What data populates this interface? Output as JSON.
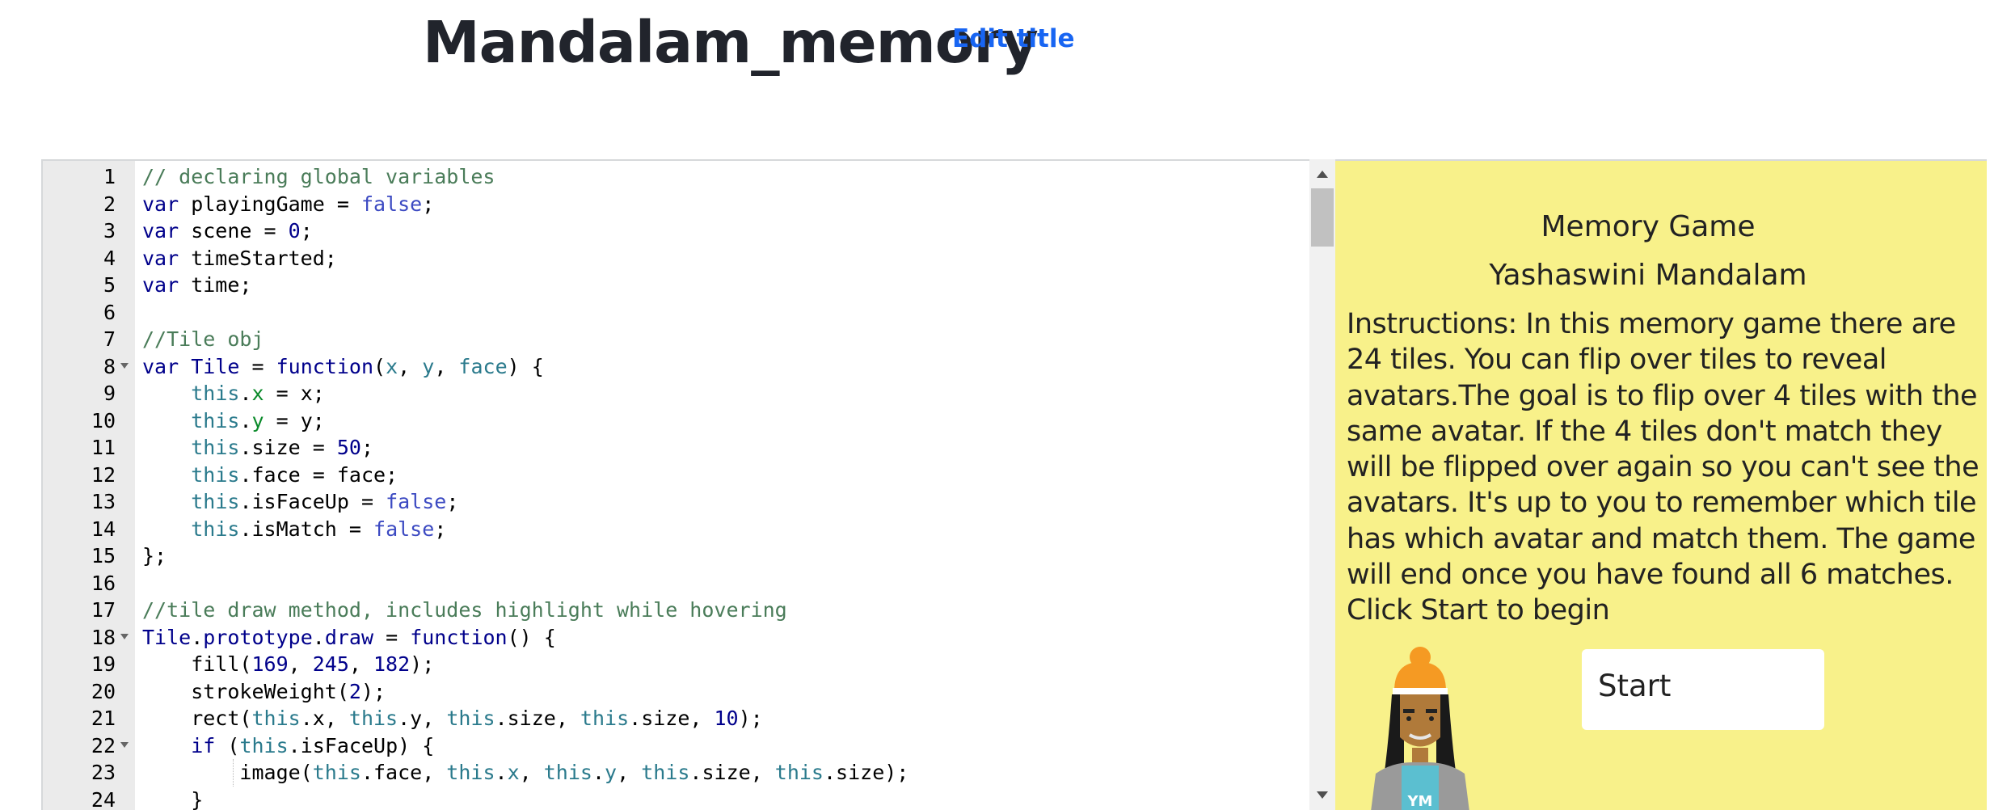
{
  "header": {
    "title": "Mandalam_memory",
    "edit_title_label": "Edit title"
  },
  "editor": {
    "lines": [
      {
        "n": "1",
        "fold": false,
        "tokens": [
          {
            "t": "// declaring global variables",
            "c": "comment"
          }
        ]
      },
      {
        "n": "2",
        "fold": false,
        "tokens": [
          {
            "t": "var",
            "c": "kw"
          },
          {
            "t": " playingGame = ",
            "c": ""
          },
          {
            "t": "false",
            "c": "bool"
          },
          {
            "t": ";",
            "c": ""
          }
        ]
      },
      {
        "n": "3",
        "fold": false,
        "tokens": [
          {
            "t": "var",
            "c": "kw"
          },
          {
            "t": " scene = ",
            "c": ""
          },
          {
            "t": "0",
            "c": "num"
          },
          {
            "t": ";",
            "c": ""
          }
        ]
      },
      {
        "n": "4",
        "fold": false,
        "tokens": [
          {
            "t": "var",
            "c": "kw"
          },
          {
            "t": " timeStarted;",
            "c": ""
          }
        ]
      },
      {
        "n": "5",
        "fold": false,
        "tokens": [
          {
            "t": "var",
            "c": "kw"
          },
          {
            "t": " time;",
            "c": ""
          }
        ]
      },
      {
        "n": "6",
        "fold": false,
        "tokens": []
      },
      {
        "n": "7",
        "fold": false,
        "tokens": [
          {
            "t": "//Tile obj",
            "c": "comment"
          }
        ]
      },
      {
        "n": "8",
        "fold": true,
        "tokens": [
          {
            "t": "var",
            "c": "kw"
          },
          {
            "t": " ",
            "c": ""
          },
          {
            "t": "Tile",
            "c": "fn"
          },
          {
            "t": " = ",
            "c": ""
          },
          {
            "t": "function",
            "c": "kw"
          },
          {
            "t": "(",
            "c": ""
          },
          {
            "t": "x",
            "c": "var"
          },
          {
            "t": ", ",
            "c": ""
          },
          {
            "t": "y",
            "c": "var"
          },
          {
            "t": ", ",
            "c": ""
          },
          {
            "t": "face",
            "c": "var"
          },
          {
            "t": ") {",
            "c": ""
          }
        ]
      },
      {
        "n": "9",
        "fold": false,
        "tokens": [
          {
            "t": "    ",
            "c": ""
          },
          {
            "t": "this",
            "c": "this"
          },
          {
            "t": ".",
            "c": ""
          },
          {
            "t": "x",
            "c": "green"
          },
          {
            "t": " = x;",
            "c": ""
          }
        ]
      },
      {
        "n": "10",
        "fold": false,
        "tokens": [
          {
            "t": "    ",
            "c": ""
          },
          {
            "t": "this",
            "c": "this"
          },
          {
            "t": ".",
            "c": ""
          },
          {
            "t": "y",
            "c": "green"
          },
          {
            "t": " = y;",
            "c": ""
          }
        ]
      },
      {
        "n": "11",
        "fold": false,
        "tokens": [
          {
            "t": "    ",
            "c": ""
          },
          {
            "t": "this",
            "c": "this"
          },
          {
            "t": ".size = ",
            "c": ""
          },
          {
            "t": "50",
            "c": "num"
          },
          {
            "t": ";",
            "c": ""
          }
        ]
      },
      {
        "n": "12",
        "fold": false,
        "tokens": [
          {
            "t": "    ",
            "c": ""
          },
          {
            "t": "this",
            "c": "this"
          },
          {
            "t": ".face = face;",
            "c": ""
          }
        ]
      },
      {
        "n": "13",
        "fold": false,
        "tokens": [
          {
            "t": "    ",
            "c": ""
          },
          {
            "t": "this",
            "c": "this"
          },
          {
            "t": ".isFaceUp = ",
            "c": ""
          },
          {
            "t": "false",
            "c": "bool"
          },
          {
            "t": ";",
            "c": ""
          }
        ]
      },
      {
        "n": "14",
        "fold": false,
        "tokens": [
          {
            "t": "    ",
            "c": ""
          },
          {
            "t": "this",
            "c": "this"
          },
          {
            "t": ".isMatch = ",
            "c": ""
          },
          {
            "t": "false",
            "c": "bool"
          },
          {
            "t": ";",
            "c": ""
          }
        ]
      },
      {
        "n": "15",
        "fold": false,
        "tokens": [
          {
            "t": "};",
            "c": ""
          }
        ]
      },
      {
        "n": "16",
        "fold": false,
        "tokens": []
      },
      {
        "n": "17",
        "fold": false,
        "tokens": [
          {
            "t": "//tile draw method, includes highlight while hovering",
            "c": "comment"
          }
        ]
      },
      {
        "n": "18",
        "fold": true,
        "tokens": [
          {
            "t": "Tile",
            "c": "fn"
          },
          {
            "t": ".",
            "c": ""
          },
          {
            "t": "prototype",
            "c": "fn"
          },
          {
            "t": ".",
            "c": ""
          },
          {
            "t": "draw",
            "c": "fn"
          },
          {
            "t": " = ",
            "c": ""
          },
          {
            "t": "function",
            "c": "kw"
          },
          {
            "t": "() {",
            "c": ""
          }
        ]
      },
      {
        "n": "19",
        "fold": false,
        "tokens": [
          {
            "t": "    fill(",
            "c": ""
          },
          {
            "t": "169",
            "c": "num"
          },
          {
            "t": ", ",
            "c": ""
          },
          {
            "t": "245",
            "c": "num"
          },
          {
            "t": ", ",
            "c": ""
          },
          {
            "t": "182",
            "c": "num"
          },
          {
            "t": ");",
            "c": ""
          }
        ]
      },
      {
        "n": "20",
        "fold": false,
        "tokens": [
          {
            "t": "    strokeWeight(",
            "c": ""
          },
          {
            "t": "2",
            "c": "num"
          },
          {
            "t": ");",
            "c": ""
          }
        ]
      },
      {
        "n": "21",
        "fold": false,
        "tokens": [
          {
            "t": "    rect(",
            "c": ""
          },
          {
            "t": "this",
            "c": "this"
          },
          {
            "t": ".x, ",
            "c": ""
          },
          {
            "t": "this",
            "c": "this"
          },
          {
            "t": ".y, ",
            "c": ""
          },
          {
            "t": "this",
            "c": "this"
          },
          {
            "t": ".size, ",
            "c": ""
          },
          {
            "t": "this",
            "c": "this"
          },
          {
            "t": ".size, ",
            "c": ""
          },
          {
            "t": "10",
            "c": "num"
          },
          {
            "t": ");",
            "c": ""
          }
        ]
      },
      {
        "n": "22",
        "fold": true,
        "tokens": [
          {
            "t": "    ",
            "c": ""
          },
          {
            "t": "if",
            "c": "kw"
          },
          {
            "t": " (",
            "c": ""
          },
          {
            "t": "this",
            "c": "this"
          },
          {
            "t": ".isFaceUp) {",
            "c": ""
          }
        ]
      },
      {
        "n": "23",
        "fold": false,
        "tokens": [
          {
            "t": "        image(",
            "c": ""
          },
          {
            "t": "this",
            "c": "this"
          },
          {
            "t": ".face, ",
            "c": ""
          },
          {
            "t": "this",
            "c": "this"
          },
          {
            "t": ".",
            "c": ""
          },
          {
            "t": "x",
            "c": "prop"
          },
          {
            "t": ", ",
            "c": ""
          },
          {
            "t": "this",
            "c": "this"
          },
          {
            "t": ".",
            "c": ""
          },
          {
            "t": "y",
            "c": "prop"
          },
          {
            "t": ", ",
            "c": ""
          },
          {
            "t": "this",
            "c": "this"
          },
          {
            "t": ".size, ",
            "c": ""
          },
          {
            "t": "this",
            "c": "this"
          },
          {
            "t": ".size);",
            "c": ""
          }
        ]
      },
      {
        "n": "24",
        "fold": false,
        "tokens": [
          {
            "t": "    }",
            "c": ""
          }
        ]
      }
    ]
  },
  "canvas": {
    "game_title": "Memory Game",
    "author": "Yashaswini Mandalam",
    "instructions": "Instructions: In this memory game there are 24 tiles. You can flip over tiles to reveal avatars.The goal is to flip over 4 tiles with the same avatar. If the 4 tiles don't match they will be flipped over again so you can't see the avatars. It's up to you to remember which tile has which avatar and match them. The game will end once you have found all 6 matches. Click Start to begin",
    "start_label": "Start",
    "avatar_initials": "YM"
  },
  "colors": {
    "canvas_bg": "#f8f18a",
    "link": "#1865f2",
    "title": "#21242c",
    "gutter": "#ebebeb"
  }
}
